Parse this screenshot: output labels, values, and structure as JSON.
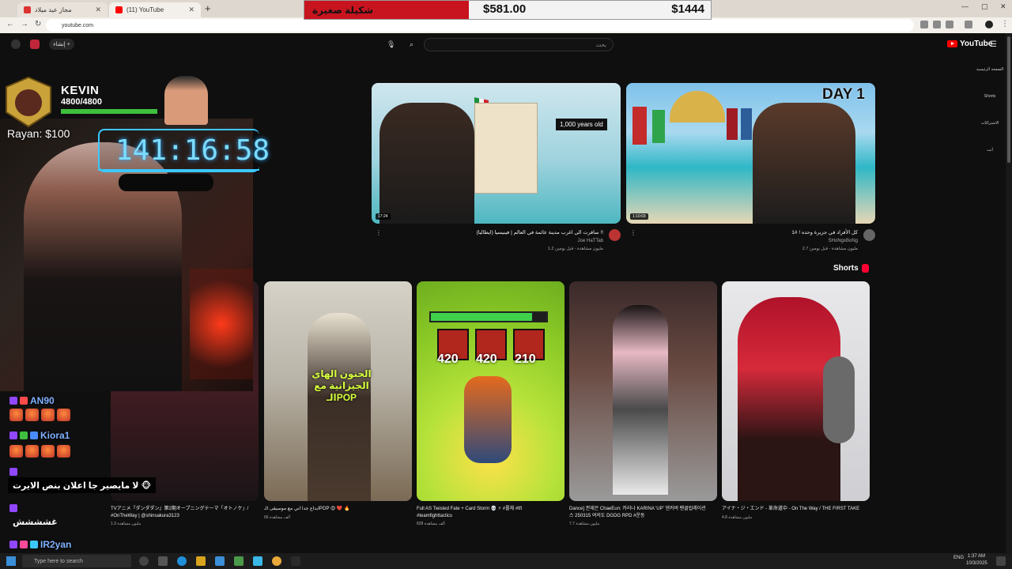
{
  "browser": {
    "tabs": [
      {
        "label": "مجاز عيد ميلاد",
        "active": false
      },
      {
        "label": "(11) YouTube",
        "active": true
      }
    ],
    "url": "youtube.com"
  },
  "overlay_banner": {
    "label": "شكيلة صغيرة",
    "price_left": "$581.00",
    "price_right": "$1444"
  },
  "yt_header": {
    "logo": "YouTube",
    "create_label": "إنشاء",
    "search_placeholder": "بحث"
  },
  "guide": [
    "الصفحة الرئيسية",
    "Shorts",
    "الاشتراكات",
    "أنت"
  ],
  "videos": [
    {
      "title": "سافرت الى اغرب مدينة عائمة في العالم | فينيسيا (ايطاليا) !!",
      "channel": "Joe HaTTab",
      "stats": "1.2 مليون مشاهدة - قبل يومين",
      "duration": "17:24",
      "overlay_text": "1,000 years old"
    },
    {
      "title": "كل الأفراد في جزيرة وحده ! #1",
      "channel": "SHoNgxBoNg",
      "stats": "2.7 مليون مشاهدة - قبل يومين",
      "duration": "1:10:03",
      "overlay_text": "DAY 1"
    }
  ],
  "shorts": {
    "label": "Shorts",
    "items": [
      {
        "title": "TVアニメ『ダンダダン』第2期オープニングテーマ「オトノケ」/ #OnTheWay | @shinsakura3123",
        "views": "1.3 مليون مشاهدة"
      },
      {
        "title": "ابداع جدا اني مع موسيقى الـPOP 😍 ❤️ 🔥",
        "views": "66 ألف مشاهدة",
        "overlay_text": "الحنون الهاي الجيزانية مع الـPOP"
      },
      {
        "title": "Full AS Twisted Fate + Card Storm 💀 ⚡ #롤체 #tft #teamfighttactics",
        "views": "828 ألف مشاهدة",
        "stats_numbers": [
          "420",
          "420",
          "210"
        ]
      },
      {
        "title": "Dance] 권재은 ChaeEun: 카리나 KARINA 'UP' 댄커버 팬클럽레이션스 250315 여의도 DGDG RPD #운동",
        "views": "7.7 مليون مشاهدة"
      },
      {
        "title": "アイナ・ジ・エンド - 革命道中 - On The Way / THE FIRST TAKE",
        "views": "4.8 مليون مشاهدة"
      }
    ]
  },
  "stream_overlay": {
    "player_name": "KEVIN",
    "hp_text": "4800/4800",
    "hp_fraction": 1.0,
    "rayan_text": "Rayan: $100",
    "timer": "141:16:58"
  },
  "chat": [
    {
      "user": "AN90",
      "message": ""
    },
    {
      "user": "Kiora1",
      "message": ""
    },
    {
      "user": "",
      "message": "لا مايصير جا اعلان بنص الايرت 🐵"
    },
    {
      "user": "",
      "message": "غشششش"
    },
    {
      "user": "IR2yan",
      "message": ""
    }
  ],
  "taskbar": {
    "search_placeholder": "Type here to search",
    "lang": "ENG",
    "time": "1:37 AM",
    "date": "10/3/2025"
  }
}
